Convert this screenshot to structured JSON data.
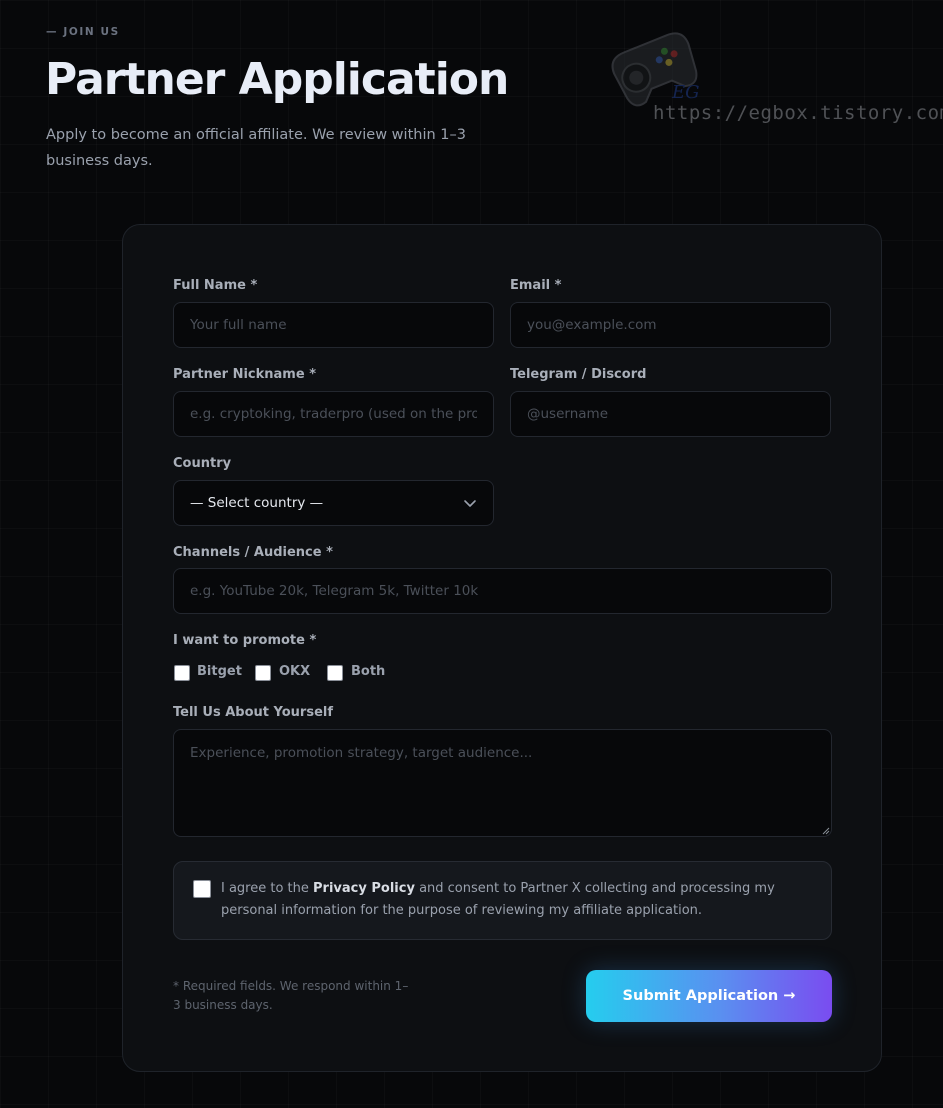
{
  "header": {
    "eyebrow": "— JOIN US",
    "title": "Partner Application",
    "subtitle": "Apply to become an official affiliate. We review within 1–3 business days."
  },
  "watermark": {
    "text": "https://egbox.tistory.com/",
    "logo_text": "EG",
    "icon": "gamepad-icon"
  },
  "form": {
    "full_name": {
      "label": "Full Name *",
      "placeholder": "Your full name"
    },
    "email": {
      "label": "Email *",
      "placeholder": "you@example.com"
    },
    "nickname": {
      "label": "Partner Nickname *",
      "placeholder": "e.g. cryptoking, traderpro (used on the program)"
    },
    "contact": {
      "label": "Telegram / Discord",
      "placeholder": "@username"
    },
    "country": {
      "label": "Country",
      "selected": "— Select country —"
    },
    "channels": {
      "label": "Channels / Audience *",
      "placeholder": "e.g. YouTube 20k, Telegram 5k, Twitter 10k"
    },
    "promote": {
      "label": "I want to promote *",
      "options": [
        {
          "label": "Bitget",
          "checked": false
        },
        {
          "label": "OKX",
          "checked": false
        },
        {
          "label": "Both",
          "checked": false
        }
      ]
    },
    "about": {
      "label": "Tell Us About Yourself",
      "placeholder": "Experience, promotion strategy, target audience..."
    },
    "consent": {
      "prefix": "I agree to the ",
      "link": "Privacy Policy",
      "suffix": " and consent to Partner X collecting and processing my personal information for the purpose of reviewing my affiliate application.",
      "checked": false
    },
    "footnote": "* Required fields. We respond within 1–3 business days.",
    "submit_label": "Submit Application →"
  },
  "colors": {
    "background": "#07080a",
    "card": "#0d0f12",
    "gradient_start": "#25cdee",
    "gradient_end": "#7a4cf0"
  }
}
